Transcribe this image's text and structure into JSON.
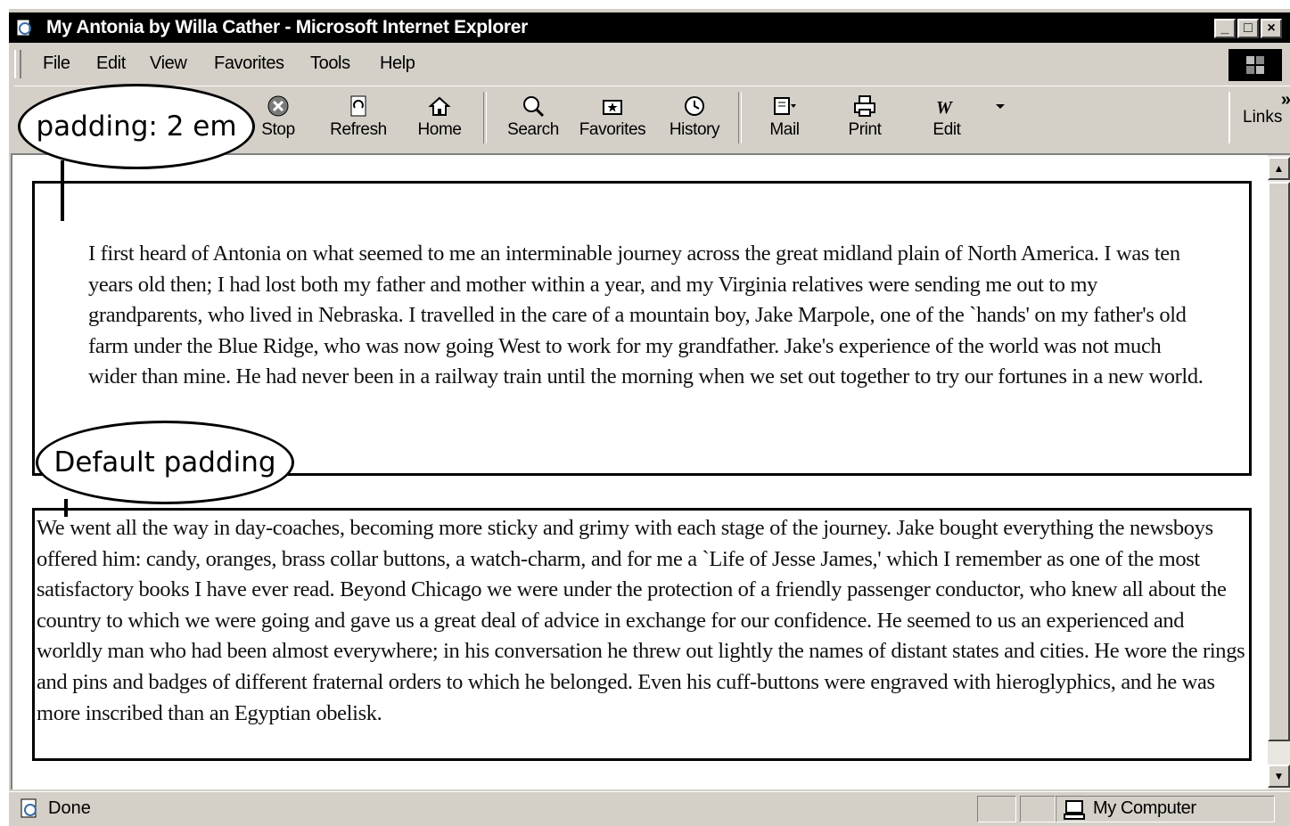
{
  "window": {
    "title": "My Antonia by Willa Cather - Microsoft Internet Explorer",
    "controls": [
      "minimize",
      "maximize",
      "close"
    ]
  },
  "menu": {
    "items": [
      {
        "label": "File"
      },
      {
        "label": "Edit"
      },
      {
        "label": "View"
      },
      {
        "label": "Favorites"
      },
      {
        "label": "Tools"
      },
      {
        "label": "Help"
      }
    ]
  },
  "toolbar": {
    "buttons": {
      "stop": "Stop",
      "refresh": "Refresh",
      "home": "Home",
      "search": "Search",
      "favorites": "Favorites",
      "history": "History",
      "mail": "Mail",
      "print": "Print",
      "edit": "Edit"
    },
    "links_label": "Links",
    "links_chevron": "»"
  },
  "content": {
    "paragraph1": "I first heard of Antonia on what seemed to me an interminable journey across the great midland plain of North America. I was ten years old then; I had lost both my father and mother within a year, and my Virginia relatives were sending me out to my grandparents, who lived in Nebraska. I travelled in the care of a mountain boy, Jake Marpole, one of the `hands' on my father's old farm under the Blue Ridge, who was now going West to work for my grandfather. Jake's experience of the world was not much wider than mine. He had never been in a railway train until the morning when we set out together to try our fortunes in a new world.",
    "paragraph2": "We went all the way in day-coaches, becoming more sticky and grimy with each stage of the journey. Jake bought everything the newsboys offered him: candy, oranges, brass collar buttons, a watch-charm, and for me a `Life of Jesse James,' which I remember as one of the most satisfactory books I have ever read. Beyond Chicago we were under the protection of a friendly passenger conductor, who knew all about the country to which we were going and gave us a great deal of advice in exchange for our confidence. He seemed to us an experienced and worldly man who had been almost everywhere; in his conversation he threw out lightly the names of distant states and cities. He wore the rings and pins and badges of different fraternal orders to which he belonged. Even his cuff-buttons were engraved with hieroglyphics, and he was more inscribed than an Egyptian obelisk."
  },
  "callouts": {
    "first": "padding: 2 em",
    "second": "Default padding"
  },
  "status": {
    "text": "Done",
    "zone": "My Computer"
  },
  "icons": [
    "ie-page-icon",
    "windows-logo",
    "stop-icon",
    "refresh-icon",
    "home-icon",
    "search-icon",
    "favorites-icon",
    "history-icon",
    "mail-icon",
    "print-icon",
    "edit-icon",
    "page-done-icon",
    "computer-icon"
  ]
}
